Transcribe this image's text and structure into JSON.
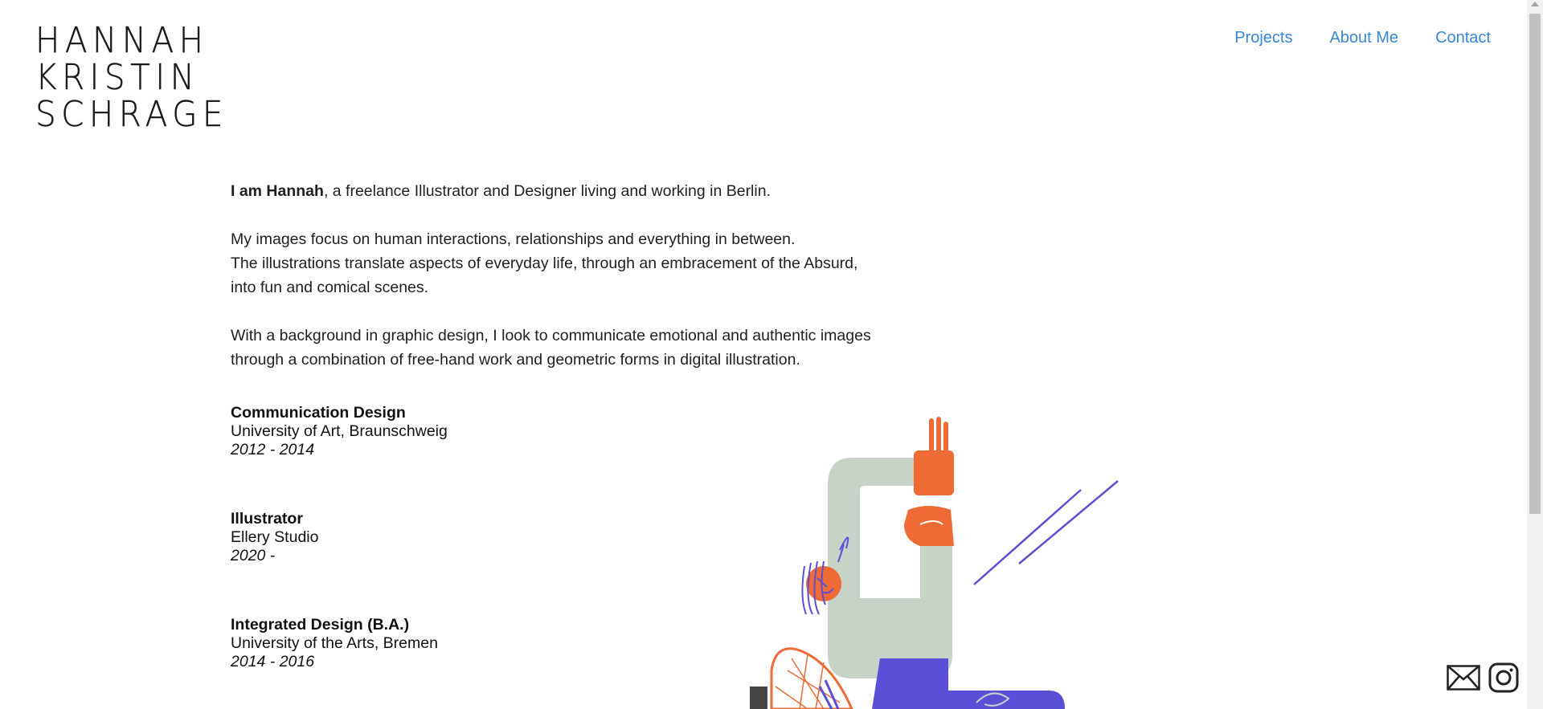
{
  "logo": {
    "lines": [
      "HANNAH",
      "KRISTIN",
      "SCHRAGE"
    ]
  },
  "nav": {
    "projects": "Projects",
    "about": "About Me",
    "contact": "Contact"
  },
  "bio": {
    "intro_bold": "I am Hannah",
    "intro_rest": ", a freelance Illustrator and Designer living and working in Berlin.",
    "para2_line1": "My images focus on human interactions, relationships and everything in between.",
    "para2_line2": "The illustrations translate aspects of everyday life, through an embracement of the Absurd,",
    "para2_line3": "into fun and comical scenes.",
    "para3_line1": "With a background in graphic design, I look to communicate emotional and authentic images",
    "para3_line2": "through a combination of free-hand work and geometric forms in digital illustration."
  },
  "cv": [
    {
      "title": "Communication Design",
      "place": "University of Art, Braunschweig",
      "years": "2012 - 2014"
    },
    {
      "title": "Illustrator",
      "place": "Ellery Studio",
      "years": "2020 -"
    },
    {
      "title": "Integrated Design (B.A.)",
      "place": "University of the Arts, Bremen",
      "years": "2014 - 2016"
    }
  ],
  "social": {
    "icons": [
      "mail-icon",
      "instagram-icon"
    ]
  },
  "colors": {
    "link": "#3a86d6",
    "illustration_grey": "#c7d3c7",
    "illustration_orange": "#ef6a34",
    "illustration_purple": "#5a4fd6"
  }
}
